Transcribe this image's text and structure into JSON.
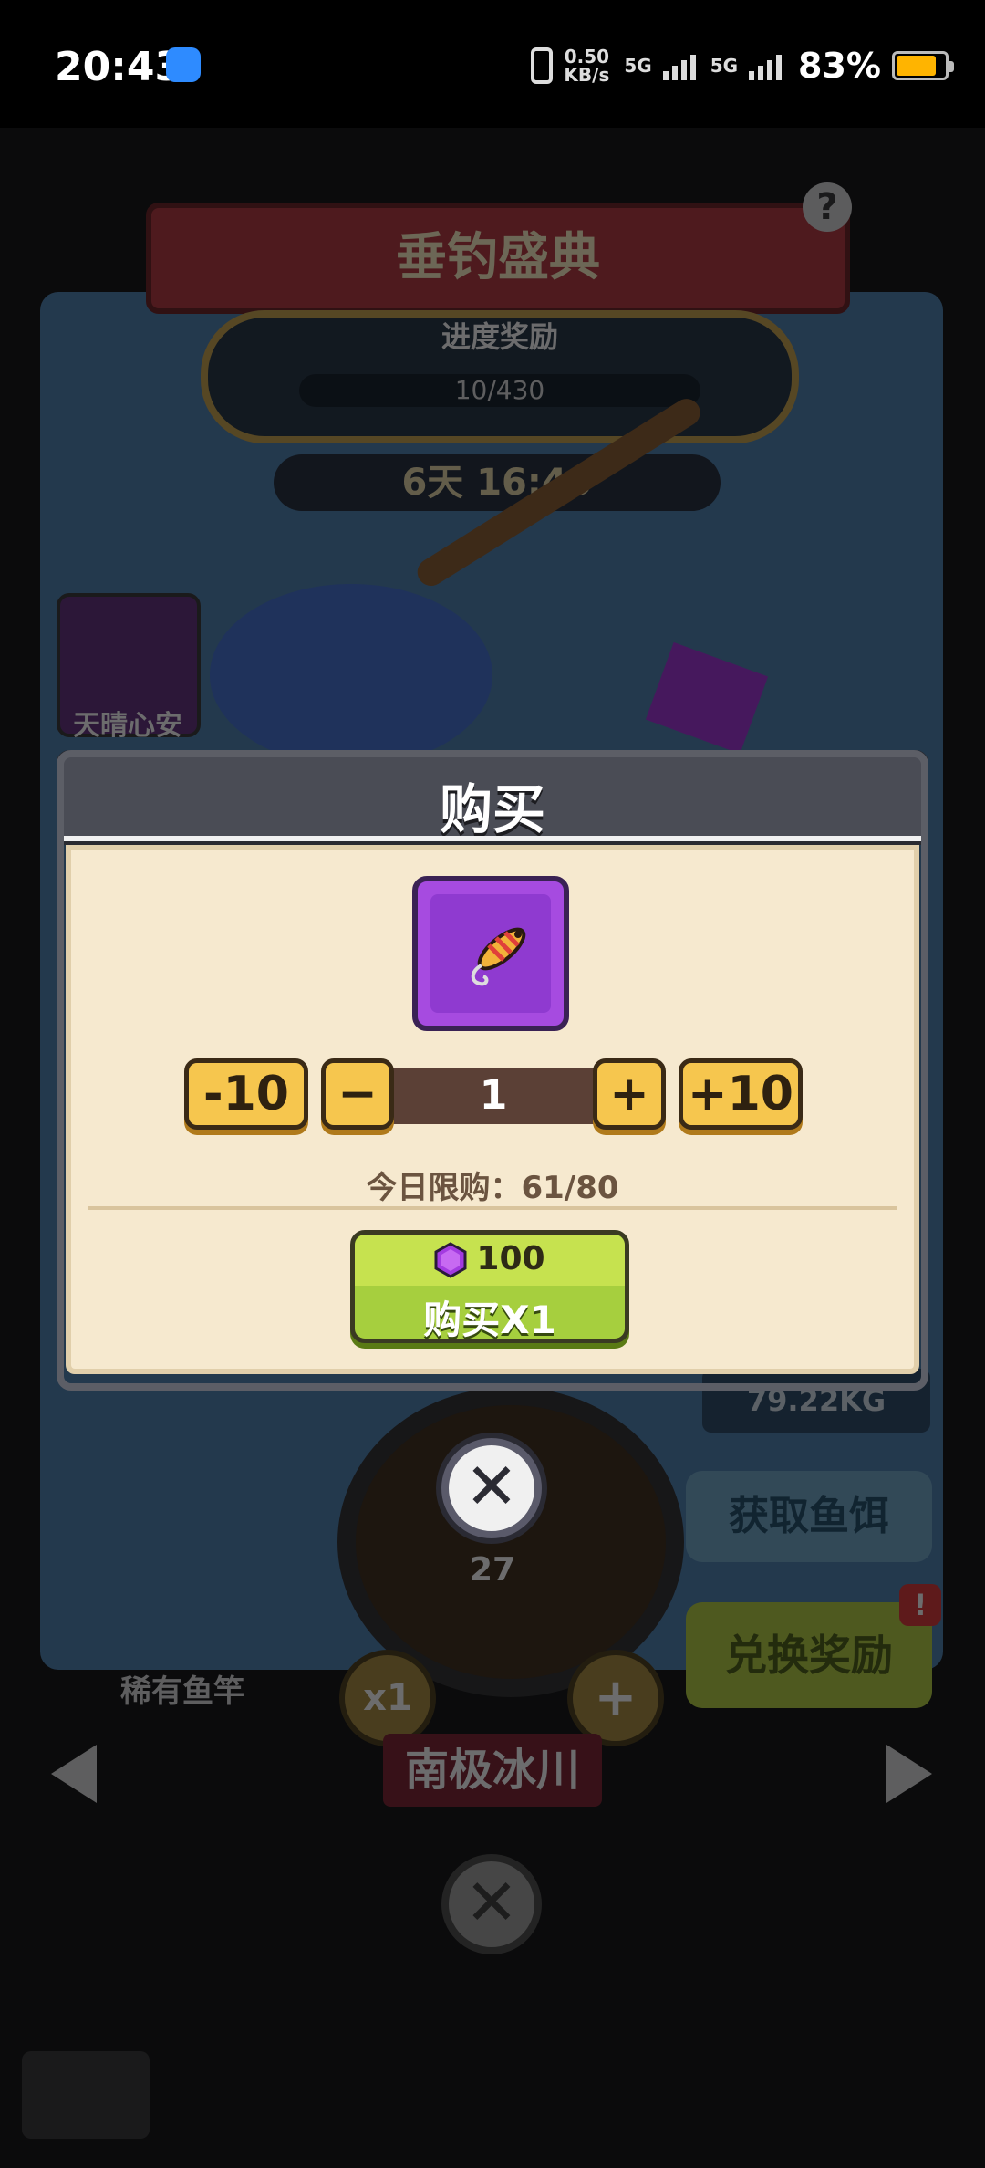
{
  "status_bar": {
    "time": "20:43",
    "net_speed_value": "0.50",
    "net_speed_unit": "KB/s",
    "network_1": "5G",
    "network_2": "5G",
    "battery": "83%",
    "battery_level": 0.83,
    "battery_color": "#ffb400"
  },
  "background": {
    "event_title": "垂钓盛典",
    "help_icon": "?",
    "progress_title": "进度奖励",
    "progress_value": "10/430",
    "timer": "6天 16:40",
    "player_name": "天晴心安",
    "weight": "79.22KG",
    "get_bait_label": "获取鱼饵",
    "exchange_reward_label": "兑换奖励",
    "badge": "!",
    "bait_count": "27",
    "multiplier": "x1",
    "plus": "+",
    "rod_label": "稀有鱼竿",
    "location": "南极冰川"
  },
  "dialog": {
    "title": "购买",
    "item_icon": "fishing-lure-icon",
    "minus10_label": "-10",
    "minus_label": "−",
    "quantity": "1",
    "plus_label": "+",
    "plus10_label": "+10",
    "daily_limit": "今日限购：61/80",
    "price": "100",
    "currency_icon": "purple-gem-icon",
    "buy_label": "购买X1",
    "close_icon": "✕"
  },
  "colors": {
    "accent_green": "#a6cf3e",
    "accent_gold": "#f6c64e",
    "item_purple": "#a64be0"
  }
}
